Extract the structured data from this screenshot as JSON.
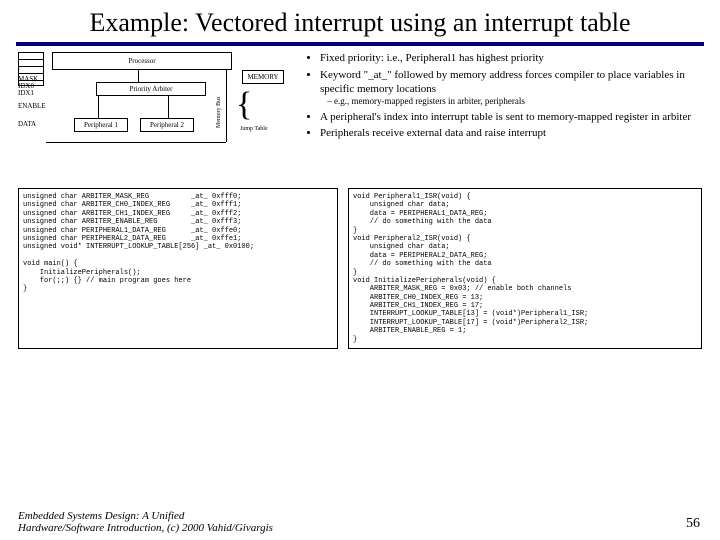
{
  "title": "Example: Vectored interrupt using an interrupt table",
  "diagram": {
    "processor": "Processor",
    "arbiter": "Priority Arbiter",
    "memory": "MEMORY",
    "p1": "Peripheral 1",
    "p2": "Peripheral 2",
    "mask": "MASK",
    "idx0": "IDX0",
    "idx1": "IDX1",
    "enable": "ENABLE",
    "data": "DATA",
    "membus": "Memory Bus",
    "jumptable": "Jump Table",
    "tdots": ":"
  },
  "bullets": [
    "Fixed priority: i.e., Peripheral1 has highest priority",
    "Keyword \"_at_\" followed by memory address forces compiler to place variables in specific memory locations",
    "A peripheral's index into interrupt table is sent to memory-mapped register in arbiter",
    "Peripherals receive external data and raise interrupt"
  ],
  "sub_bullet": "e.g., memory-mapped registers in arbiter, peripherals",
  "code_left": "unsigned char ARBITER_MASK_REG          _at_ 0xfff0;\nunsigned char ARBITER_CH0_INDEX_REG     _at_ 0xfff1;\nunsigned char ARBITER_CH1_INDEX_REG     _at_ 0xfff2;\nunsigned char ARBITER_ENABLE_REG        _at_ 0xfff3;\nunsigned char PERIPHERAL1_DATA_REG      _at_ 0xffe0;\nunsigned char PERIPHERAL2_DATA_REG      _at_ 0xffe1;\nunsigned void* INTERRUPT_LOOKUP_TABLE[256] _at_ 0x0100;\n\nvoid main() {\n    InitializePeripherals();\n    for(;;) {} // main program goes here\n}",
  "code_right": "void Peripheral1_ISR(void) {\n    unsigned char data;\n    data = PERIPHERAL1_DATA_REG;\n    // do something with the data\n}\nvoid Peripheral2_ISR(void) {\n    unsigned char data;\n    data = PERIPHERAL2_DATA_REG;\n    // do something with the data\n}\nvoid InitializePeripherals(void) {\n    ARBITER_MASK_REG = 0x03; // enable both channels\n    ARBITER_CH0_INDEX_REG = 13;\n    ARBITER_CH1_INDEX_REG = 17;\n    INTERRUPT_LOOKUP_TABLE[13] = (void*)Peripheral1_ISR;\n    INTERRUPT_LOOKUP_TABLE[17] = (void*)Peripheral2_ISR;\n    ARBITER_ENABLE_REG = 1;\n}",
  "footer_line1": "Embedded Systems Design: A Unified",
  "footer_line2": "Hardware/Software Introduction, (c) 2000 Vahid/Givargis",
  "page_number": "56"
}
